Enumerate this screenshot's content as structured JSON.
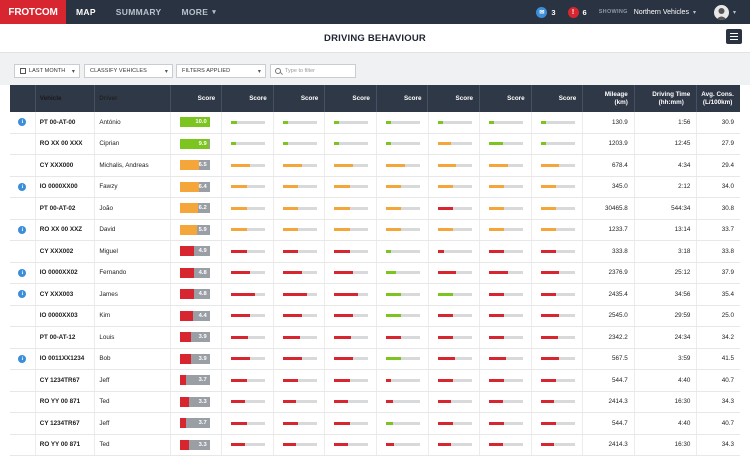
{
  "nav": {
    "brand": "FROTCOM",
    "items": [
      {
        "label": "MAP",
        "active": true
      },
      {
        "label": "SUMMARY",
        "active": false
      },
      {
        "label": "MORE",
        "active": false,
        "caret": "▾"
      }
    ],
    "messages_count": "3",
    "alerts_count": "6",
    "showing_label": "SHOWING",
    "showing_value": "Northern Vehicles",
    "caret": "▾"
  },
  "header": {
    "title": "DRIVING BEHAVIOUR"
  },
  "filters": {
    "date": "LAST MONTH",
    "classify": "CLASSIFY VEHICLES",
    "applied": "FILTERS APPLIED",
    "search_placeholder": "Type to filter",
    "caret": "▾"
  },
  "colors": {
    "green": "#7cc520",
    "orange": "#f4a63a",
    "red": "#d7262f",
    "info": "#3b8ed8",
    "header_bg": "#2f3846"
  },
  "table": {
    "headers": {
      "vehicle": "Vehicle",
      "driver": "Driver",
      "score": "Score",
      "metric_score": "Score",
      "mileage_1": "Mileage",
      "mileage_2": "(km)",
      "time_1": "Driving Time",
      "time_2": "(hh:mm)",
      "cons_1": "Avg. Cons.",
      "cons_2": "(L/100km)"
    },
    "rows": [
      {
        "info": true,
        "vehicle": "PT 00-AT-00",
        "driver": "António",
        "score": "10.0",
        "level": 1.0,
        "metrics": [
          0.18,
          0.15,
          0.15,
          0.15,
          0.15,
          0.15,
          0.15
        ],
        "mcolors": [
          "green",
          "green",
          "green",
          "green",
          "green",
          "green",
          "green"
        ],
        "mileage": "130.9",
        "time": "1:56",
        "cons": "30.9"
      },
      {
        "info": false,
        "vehicle": "RO XX 00 XXX",
        "driver": "Ciprian",
        "score": "9.9",
        "level": 0.99,
        "metrics": [
          0.15,
          0.15,
          0.15,
          0.15,
          0.4,
          0.4,
          0.15
        ],
        "mcolors": [
          "green",
          "green",
          "green",
          "green",
          "orange",
          "green",
          "green"
        ],
        "mileage": "1203.9",
        "time": "12:45",
        "cons": "27.9"
      },
      {
        "info": false,
        "vehicle": "CY XXX000",
        "driver": "Michalis, Andreas",
        "score": "6.5",
        "level": 0.65,
        "metrics": [
          0.55,
          0.55,
          0.55,
          0.55,
          0.55,
          0.55,
          0.55
        ],
        "mcolors": [
          "orange",
          "orange",
          "orange",
          "orange",
          "orange",
          "orange",
          "orange"
        ],
        "mileage": "678.4",
        "time": "4:34",
        "cons": "29.4"
      },
      {
        "info": true,
        "vehicle": "IO 0000XX00",
        "driver": "Fawzy",
        "score": "6.4",
        "level": 0.64,
        "metrics": [
          0.45,
          0.45,
          0.45,
          0.45,
          0.45,
          0.45,
          0.45
        ],
        "mcolors": [
          "orange",
          "orange",
          "orange",
          "orange",
          "orange",
          "orange",
          "orange"
        ],
        "mileage": "345.0",
        "time": "2:12",
        "cons": "34.0"
      },
      {
        "info": false,
        "vehicle": "PT 00-AT-02",
        "driver": "João",
        "score": "6.2",
        "level": 0.62,
        "metrics": [
          0.45,
          0.45,
          0.45,
          0.45,
          0.45,
          0.45,
          0.45
        ],
        "mcolors": [
          "orange",
          "orange",
          "orange",
          "orange",
          "red",
          "orange",
          "orange"
        ],
        "mileage": "30465.8",
        "time": "544:34",
        "cons": "30.8"
      },
      {
        "info": true,
        "vehicle": "RO XX 00 XXZ",
        "driver": "David",
        "score": "5.9",
        "level": 0.59,
        "metrics": [
          0.45,
          0.45,
          0.45,
          0.45,
          0.45,
          0.45,
          0.45
        ],
        "mcolors": [
          "orange",
          "orange",
          "orange",
          "orange",
          "orange",
          "orange",
          "orange"
        ],
        "mileage": "1233.7",
        "time": "13:14",
        "cons": "33.7"
      },
      {
        "info": false,
        "vehicle": "CY XXX002",
        "driver": "Miguel",
        "score": "4.9",
        "level": 0.49,
        "metrics": [
          0.45,
          0.45,
          0.45,
          0.15,
          0.2,
          0.45,
          0.45
        ],
        "mcolors": [
          "red",
          "red",
          "red",
          "green",
          "red",
          "red",
          "red"
        ],
        "mileage": "333.8",
        "time": "3:18",
        "cons": "33.8"
      },
      {
        "info": true,
        "vehicle": "IO 0000XX02",
        "driver": "Fernando",
        "score": "4.8",
        "level": 0.48,
        "metrics": [
          0.55,
          0.55,
          0.55,
          0.3,
          0.55,
          0.55,
          0.55
        ],
        "mcolors": [
          "red",
          "red",
          "red",
          "green",
          "red",
          "red",
          "red"
        ],
        "mileage": "2376.9",
        "time": "25:12",
        "cons": "37.9"
      },
      {
        "info": true,
        "vehicle": "CY XXX003",
        "driver": "James",
        "score": "4.8",
        "level": 0.48,
        "metrics": [
          0.7,
          0.7,
          0.7,
          0.45,
          0.45,
          0.45,
          0.45
        ],
        "mcolors": [
          "red",
          "red",
          "red",
          "green",
          "green",
          "red",
          "red"
        ],
        "mileage": "2435.4",
        "time": "34:56",
        "cons": "35.4"
      },
      {
        "info": false,
        "vehicle": "IO 0000XX03",
        "driver": "Kim",
        "score": "4.4",
        "level": 0.44,
        "metrics": [
          0.55,
          0.55,
          0.55,
          0.45,
          0.45,
          0.45,
          0.55
        ],
        "mcolors": [
          "red",
          "red",
          "red",
          "green",
          "red",
          "red",
          "red"
        ],
        "mileage": "2545.0",
        "time": "29:59",
        "cons": "25.0"
      },
      {
        "info": false,
        "vehicle": "PT 00-AT-12",
        "driver": "Louis",
        "score": "3.9",
        "level": 0.39,
        "metrics": [
          0.5,
          0.5,
          0.5,
          0.45,
          0.45,
          0.45,
          0.5
        ],
        "mcolors": [
          "red",
          "red",
          "red",
          "red",
          "red",
          "red",
          "red"
        ],
        "mileage": "2342.2",
        "time": "24:34",
        "cons": "34.2"
      },
      {
        "info": true,
        "vehicle": "IO 0011XX1234",
        "driver": "Bob",
        "score": "3.9",
        "level": 0.39,
        "metrics": [
          0.55,
          0.55,
          0.55,
          0.45,
          0.5,
          0.5,
          0.55
        ],
        "mcolors": [
          "red",
          "red",
          "red",
          "green",
          "red",
          "red",
          "red"
        ],
        "mileage": "567.5",
        "time": "3:59",
        "cons": "41.5"
      },
      {
        "info": false,
        "vehicle": "CY 1234TR67",
        "driver": "Jeff",
        "score": "3.7",
        "level": 0.2,
        "metrics": [
          0.45,
          0.45,
          0.45,
          0.15,
          0.45,
          0.45,
          0.45
        ],
        "mcolors": [
          "red",
          "red",
          "red",
          "red",
          "red",
          "red",
          "red"
        ],
        "mileage": "544.7",
        "time": "4:40",
        "cons": "40.7"
      },
      {
        "info": false,
        "vehicle": "RO YY 00 871",
        "driver": "Ted",
        "score": "3.3",
        "level": 0.3,
        "metrics": [
          0.4,
          0.4,
          0.4,
          0.2,
          0.4,
          0.4,
          0.4
        ],
        "mcolors": [
          "red",
          "red",
          "red",
          "red",
          "red",
          "red",
          "red"
        ],
        "mileage": "2414.3",
        "time": "16:30",
        "cons": "34.3"
      },
      {
        "info": false,
        "vehicle": "CY 1234TR67",
        "driver": "Jeff",
        "score": "3.7",
        "level": 0.2,
        "metrics": [
          0.45,
          0.45,
          0.45,
          0.2,
          0.45,
          0.45,
          0.45
        ],
        "mcolors": [
          "red",
          "red",
          "red",
          "green",
          "red",
          "red",
          "red"
        ],
        "mileage": "544.7",
        "time": "4:40",
        "cons": "40.7"
      },
      {
        "info": false,
        "vehicle": "RO YY 00 871",
        "driver": "Ted",
        "score": "3.3",
        "level": 0.3,
        "metrics": [
          0.4,
          0.4,
          0.4,
          0.25,
          0.4,
          0.4,
          0.4
        ],
        "mcolors": [
          "red",
          "red",
          "red",
          "red",
          "red",
          "red",
          "red"
        ],
        "mileage": "2414.3",
        "time": "16:30",
        "cons": "34.3"
      }
    ]
  }
}
